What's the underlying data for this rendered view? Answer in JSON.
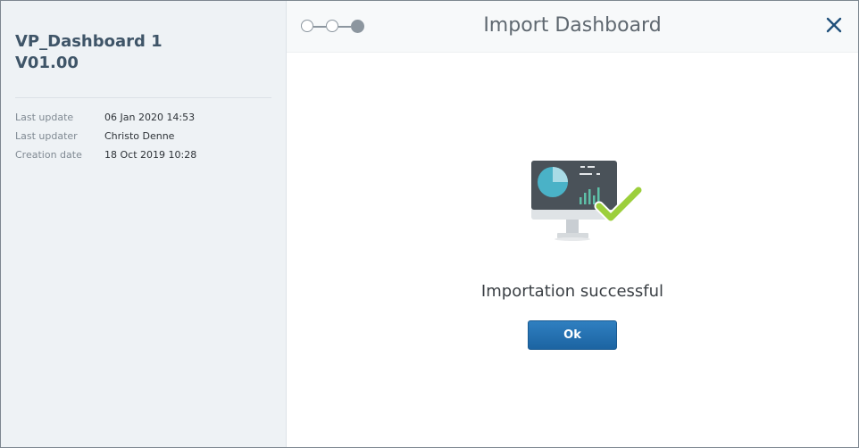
{
  "dashboard": {
    "name": "VP_Dashboard 1",
    "version": "V01.00"
  },
  "meta": [
    {
      "label": "Last update",
      "value": "06 Jan 2020 14:53"
    },
    {
      "label": "Last updater",
      "value": "Christo Denne"
    },
    {
      "label": "Creation date",
      "value": "18 Oct 2019 10:28"
    }
  ],
  "header": {
    "title": "Import Dashboard",
    "steps_total": 3,
    "current_step": 3
  },
  "body": {
    "message": "Importation successful",
    "ok_label": "Ok",
    "illustration_icon": "monitor-success-icon"
  },
  "icons": {
    "close": "close-icon"
  },
  "colors": {
    "accent": "#1f6aab",
    "check": "#9ccf3b",
    "heading": "#3f5568",
    "panel_bg": "#eef2f5"
  }
}
